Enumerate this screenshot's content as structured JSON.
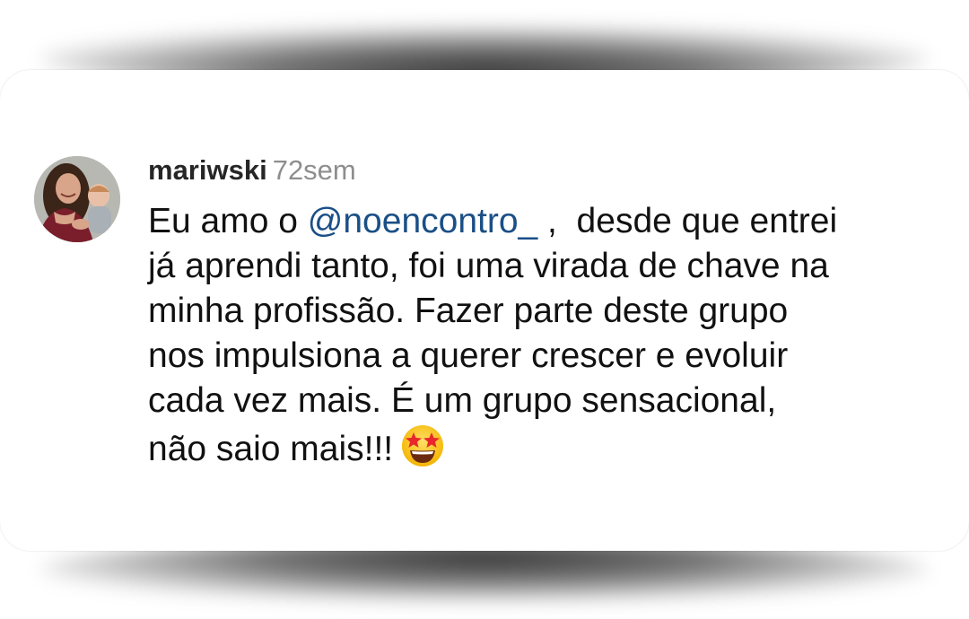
{
  "comment": {
    "username": "mariwski",
    "time": "72sem",
    "avatar_icon": "profile-photo-mother-with-baby",
    "text": {
      "line1_pre": "Eu amo o ",
      "mention": "@noencontro_",
      "line1_post": " ,  desde que entrei",
      "line2": "já aprendi tanto, foi uma virada de chave na",
      "line3": "minha profissão. Fazer parte deste grupo",
      "line4": "nos impulsiona a querer crescer e evoluir",
      "line5": "cada vez mais. É um grupo sensacional,",
      "line6": "não saio mais!!!"
    },
    "emoji_icon": "star-struck-emoji"
  },
  "colors": {
    "username": "#262626",
    "time": "#8e8e8e",
    "mention": "#1a4f86",
    "text": "#111111"
  }
}
